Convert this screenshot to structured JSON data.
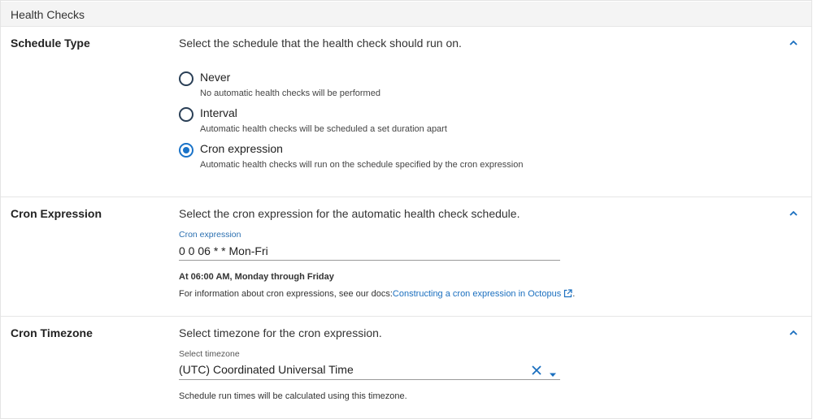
{
  "header": {
    "title": "Health Checks"
  },
  "schedule": {
    "title": "Schedule Type",
    "description": "Select the schedule that the health check should run on.",
    "options": [
      {
        "label": "Never",
        "help": "No automatic health checks will be performed",
        "checked": false
      },
      {
        "label": "Interval",
        "help": "Automatic health checks will be scheduled a set duration apart",
        "checked": false
      },
      {
        "label": "Cron expression",
        "help": "Automatic health checks will run on the schedule specified by the cron expression",
        "checked": true
      }
    ]
  },
  "cron": {
    "title": "Cron Expression",
    "description": "Select the cron expression for the automatic health check schedule.",
    "field_label": "Cron expression",
    "field_value": "0 0 06 * * Mon-Fri",
    "summary": "At 06:00 AM, Monday through Friday",
    "info_prefix": "For information about cron expressions, see our docs:",
    "info_link": "Constructing a cron expression in Octopus",
    "info_suffix": "."
  },
  "timezone": {
    "title": "Cron Timezone",
    "description": "Select timezone for the cron expression.",
    "field_label": "Select timezone",
    "field_value": "(UTC) Coordinated Universal Time",
    "note": "Schedule run times will be calculated using this timezone."
  },
  "colors": {
    "accent": "#1a73c8",
    "link": "#1a6fbf",
    "header_bg": "#f4f4f4"
  },
  "icons": {
    "collapse": "chevron-up-icon",
    "external": "external-link-icon",
    "clear": "close-icon",
    "dropdown": "caret-down-icon"
  }
}
